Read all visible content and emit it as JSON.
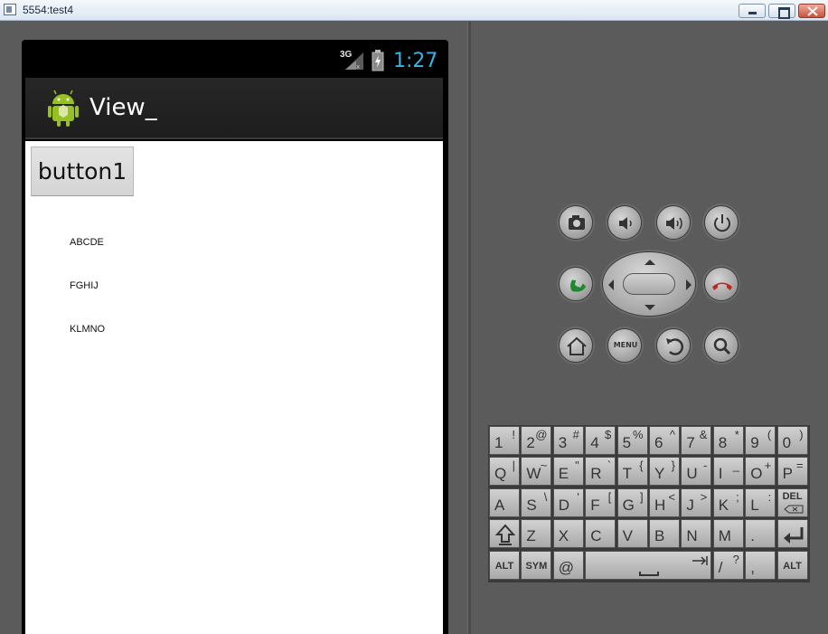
{
  "window": {
    "title": "5554:test4"
  },
  "status_bar": {
    "network": "3G",
    "clock": "1:27"
  },
  "app": {
    "title": "View_",
    "button_label": "button1",
    "text_lines": [
      "ABCDE",
      "FGHIJ",
      "KLMNO"
    ]
  },
  "hardware": {
    "menu_label": "MENU"
  },
  "colors": {
    "clock": "#33b5e5",
    "call_green": "#1e8a2e",
    "end_red": "#c0271f"
  },
  "keyboard": {
    "row1": [
      [
        "1",
        "!"
      ],
      [
        "2",
        "@"
      ],
      [
        "3",
        "#"
      ],
      [
        "4",
        "$"
      ],
      [
        "5",
        "%"
      ],
      [
        "6",
        "^"
      ],
      [
        "7",
        "&"
      ],
      [
        "8",
        "*"
      ],
      [
        "9",
        "("
      ],
      [
        "0",
        ")"
      ]
    ],
    "row2": [
      [
        "Q",
        "|"
      ],
      [
        "W",
        "~"
      ],
      [
        "E",
        "\""
      ],
      [
        "R",
        "`"
      ],
      [
        "T",
        "{"
      ],
      [
        "Y",
        "}"
      ],
      [
        "U",
        "-"
      ],
      [
        "I",
        "_"
      ],
      [
        "O",
        "+"
      ],
      [
        "P",
        "="
      ]
    ],
    "row3": [
      [
        "A",
        ""
      ],
      [
        "S",
        "\\"
      ],
      [
        "D",
        "'"
      ],
      [
        "F",
        "["
      ],
      [
        "G",
        "]"
      ],
      [
        "H",
        "<"
      ],
      [
        "J",
        ">"
      ],
      [
        "K",
        ";"
      ],
      [
        "L",
        ":"
      ]
    ],
    "row4": [
      [
        "Z",
        ""
      ],
      [
        "X",
        ""
      ],
      [
        "C",
        ""
      ],
      [
        "V",
        ""
      ],
      [
        "B",
        ""
      ],
      [
        "N",
        ""
      ],
      [
        "M",
        ""
      ],
      [
        ".",
        ""
      ]
    ],
    "del_label": "DEL",
    "alt_label": "ALT",
    "sym_label": "SYM",
    "at_label": "@",
    "slash": [
      "/",
      "?"
    ],
    "comma": ","
  }
}
